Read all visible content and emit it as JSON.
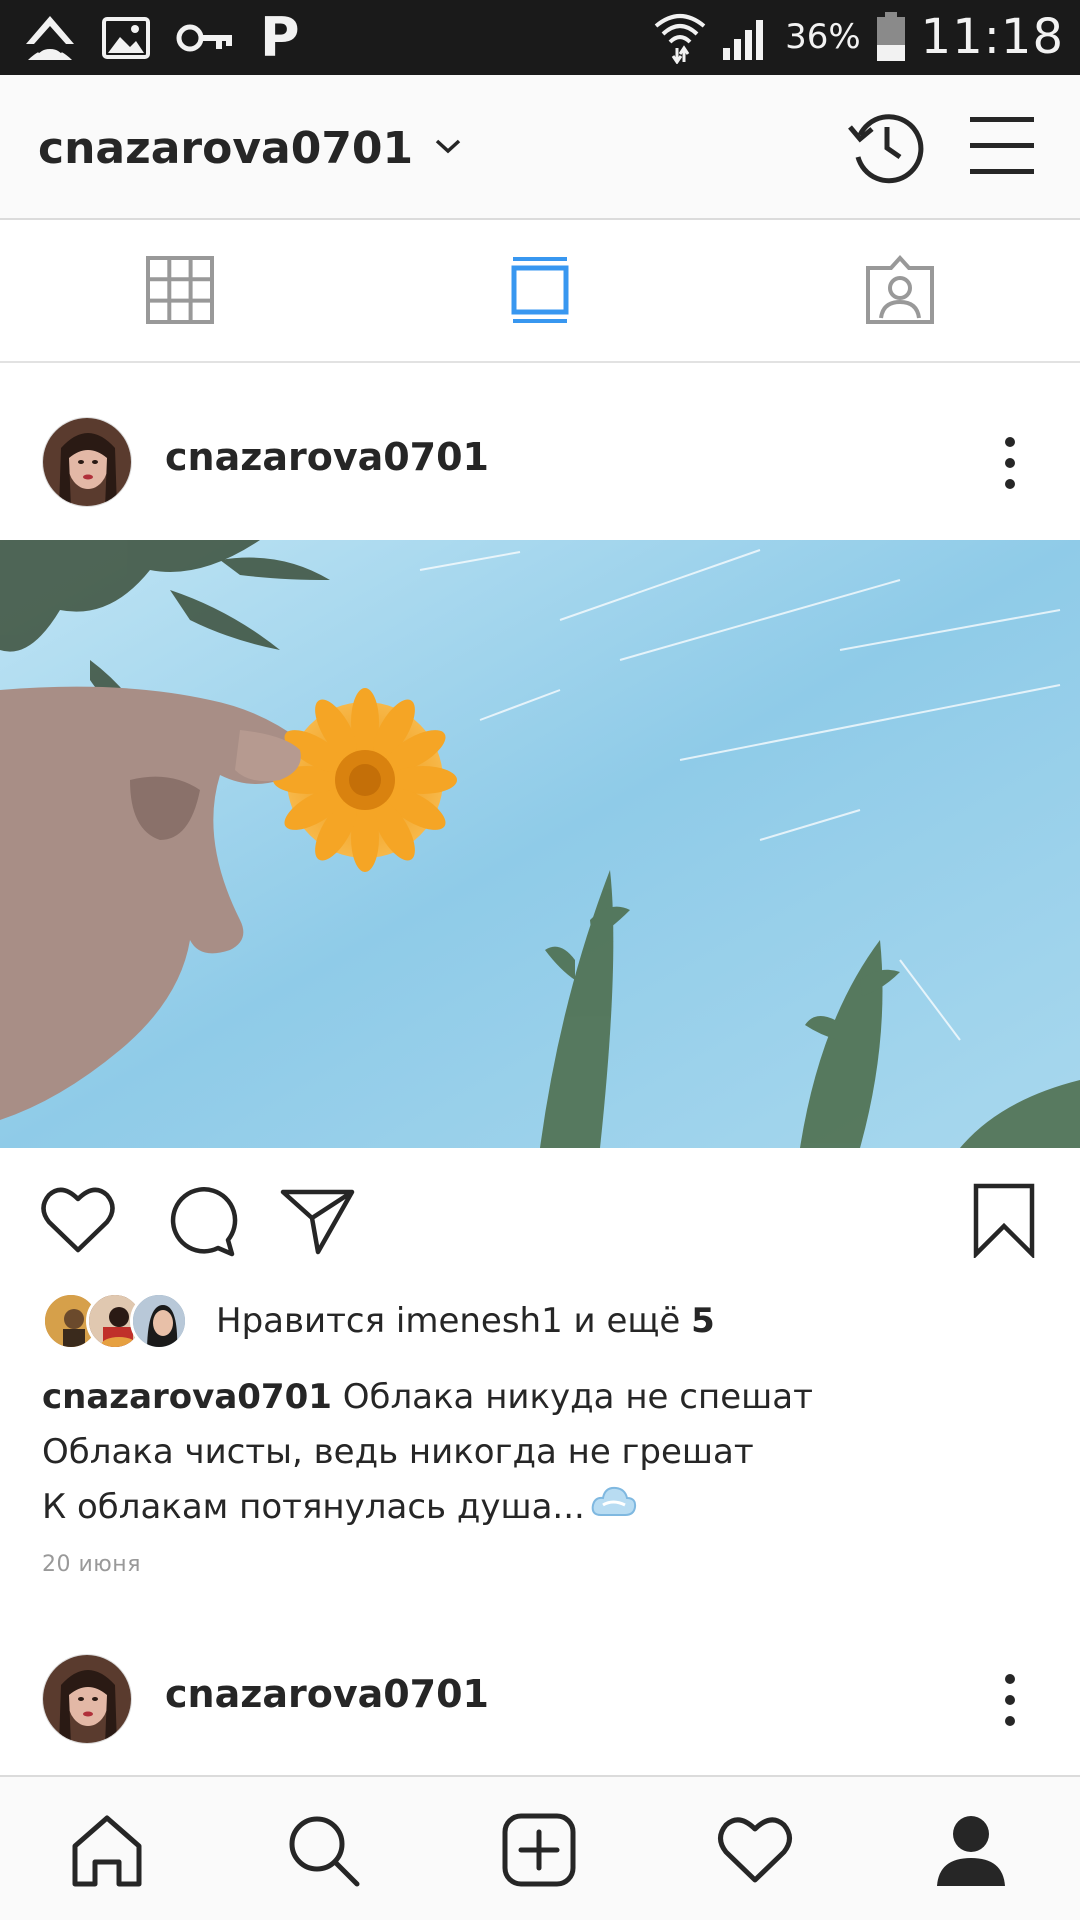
{
  "status_bar": {
    "battery": "36%",
    "time": "11:18",
    "notification_letter": "P"
  },
  "header": {
    "username": "cnazarova0701"
  },
  "tabs": [
    {
      "name": "grid-view",
      "active": false
    },
    {
      "name": "feed-view",
      "active": true
    },
    {
      "name": "tagged-view",
      "active": false
    }
  ],
  "posts": [
    {
      "username": "cnazarova0701",
      "likes": {
        "prefix": "Нравится ",
        "user": "imenesh1",
        "middle": " и ещё ",
        "count": "5"
      },
      "caption": {
        "username": "cnazarova0701",
        "line1": " Облака никуда не спешат",
        "line2": "Облака чисты, ведь никогда не грешат",
        "line3": "К облакам потянулась душа..."
      },
      "date": "20 июня"
    },
    {
      "username": "cnazarova0701"
    }
  ],
  "colors": {
    "active_tab": "#3897f0",
    "inactive_icon": "#999999",
    "text": "#262626",
    "status_bar_bg": "#1a1a1a"
  },
  "icons": {
    "status_left": [
      "app-notification-icon",
      "image-icon",
      "key-icon",
      "p-letter-icon"
    ],
    "status_right": [
      "wifi-icon",
      "signal-icon",
      "battery-icon"
    ],
    "header": [
      "chevron-down-icon",
      "history-icon",
      "hamburger-menu-icon"
    ],
    "actions": [
      "heart-icon",
      "comment-icon",
      "share-icon",
      "bookmark-icon"
    ],
    "bottom_nav": [
      "home-icon",
      "search-icon",
      "add-post-icon",
      "activity-heart-icon",
      "profile-icon"
    ]
  }
}
